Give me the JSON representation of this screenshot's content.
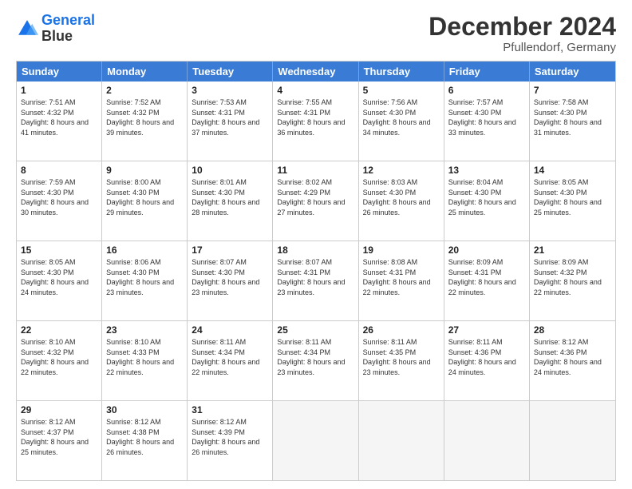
{
  "logo": {
    "line1": "General",
    "line2": "Blue"
  },
  "title": "December 2024",
  "subtitle": "Pfullendorf, Germany",
  "header_days": [
    "Sunday",
    "Monday",
    "Tuesday",
    "Wednesday",
    "Thursday",
    "Friday",
    "Saturday"
  ],
  "weeks": [
    [
      {
        "day": "1",
        "sunrise": "7:51 AM",
        "sunset": "4:32 PM",
        "daylight": "8 hours and 41 minutes."
      },
      {
        "day": "2",
        "sunrise": "7:52 AM",
        "sunset": "4:32 PM",
        "daylight": "8 hours and 39 minutes."
      },
      {
        "day": "3",
        "sunrise": "7:53 AM",
        "sunset": "4:31 PM",
        "daylight": "8 hours and 37 minutes."
      },
      {
        "day": "4",
        "sunrise": "7:55 AM",
        "sunset": "4:31 PM",
        "daylight": "8 hours and 36 minutes."
      },
      {
        "day": "5",
        "sunrise": "7:56 AM",
        "sunset": "4:30 PM",
        "daylight": "8 hours and 34 minutes."
      },
      {
        "day": "6",
        "sunrise": "7:57 AM",
        "sunset": "4:30 PM",
        "daylight": "8 hours and 33 minutes."
      },
      {
        "day": "7",
        "sunrise": "7:58 AM",
        "sunset": "4:30 PM",
        "daylight": "8 hours and 31 minutes."
      }
    ],
    [
      {
        "day": "8",
        "sunrise": "7:59 AM",
        "sunset": "4:30 PM",
        "daylight": "8 hours and 30 minutes."
      },
      {
        "day": "9",
        "sunrise": "8:00 AM",
        "sunset": "4:30 PM",
        "daylight": "8 hours and 29 minutes."
      },
      {
        "day": "10",
        "sunrise": "8:01 AM",
        "sunset": "4:30 PM",
        "daylight": "8 hours and 28 minutes."
      },
      {
        "day": "11",
        "sunrise": "8:02 AM",
        "sunset": "4:29 PM",
        "daylight": "8 hours and 27 minutes."
      },
      {
        "day": "12",
        "sunrise": "8:03 AM",
        "sunset": "4:30 PM",
        "daylight": "8 hours and 26 minutes."
      },
      {
        "day": "13",
        "sunrise": "8:04 AM",
        "sunset": "4:30 PM",
        "daylight": "8 hours and 25 minutes."
      },
      {
        "day": "14",
        "sunrise": "8:05 AM",
        "sunset": "4:30 PM",
        "daylight": "8 hours and 25 minutes."
      }
    ],
    [
      {
        "day": "15",
        "sunrise": "8:05 AM",
        "sunset": "4:30 PM",
        "daylight": "8 hours and 24 minutes."
      },
      {
        "day": "16",
        "sunrise": "8:06 AM",
        "sunset": "4:30 PM",
        "daylight": "8 hours and 23 minutes."
      },
      {
        "day": "17",
        "sunrise": "8:07 AM",
        "sunset": "4:30 PM",
        "daylight": "8 hours and 23 minutes."
      },
      {
        "day": "18",
        "sunrise": "8:07 AM",
        "sunset": "4:31 PM",
        "daylight": "8 hours and 23 minutes."
      },
      {
        "day": "19",
        "sunrise": "8:08 AM",
        "sunset": "4:31 PM",
        "daylight": "8 hours and 22 minutes."
      },
      {
        "day": "20",
        "sunrise": "8:09 AM",
        "sunset": "4:31 PM",
        "daylight": "8 hours and 22 minutes."
      },
      {
        "day": "21",
        "sunrise": "8:09 AM",
        "sunset": "4:32 PM",
        "daylight": "8 hours and 22 minutes."
      }
    ],
    [
      {
        "day": "22",
        "sunrise": "8:10 AM",
        "sunset": "4:32 PM",
        "daylight": "8 hours and 22 minutes."
      },
      {
        "day": "23",
        "sunrise": "8:10 AM",
        "sunset": "4:33 PM",
        "daylight": "8 hours and 22 minutes."
      },
      {
        "day": "24",
        "sunrise": "8:11 AM",
        "sunset": "4:34 PM",
        "daylight": "8 hours and 22 minutes."
      },
      {
        "day": "25",
        "sunrise": "8:11 AM",
        "sunset": "4:34 PM",
        "daylight": "8 hours and 23 minutes."
      },
      {
        "day": "26",
        "sunrise": "8:11 AM",
        "sunset": "4:35 PM",
        "daylight": "8 hours and 23 minutes."
      },
      {
        "day": "27",
        "sunrise": "8:11 AM",
        "sunset": "4:36 PM",
        "daylight": "8 hours and 24 minutes."
      },
      {
        "day": "28",
        "sunrise": "8:12 AM",
        "sunset": "4:36 PM",
        "daylight": "8 hours and 24 minutes."
      }
    ],
    [
      {
        "day": "29",
        "sunrise": "8:12 AM",
        "sunset": "4:37 PM",
        "daylight": "8 hours and 25 minutes."
      },
      {
        "day": "30",
        "sunrise": "8:12 AM",
        "sunset": "4:38 PM",
        "daylight": "8 hours and 26 minutes."
      },
      {
        "day": "31",
        "sunrise": "8:12 AM",
        "sunset": "4:39 PM",
        "daylight": "8 hours and 26 minutes."
      },
      null,
      null,
      null,
      null
    ]
  ]
}
